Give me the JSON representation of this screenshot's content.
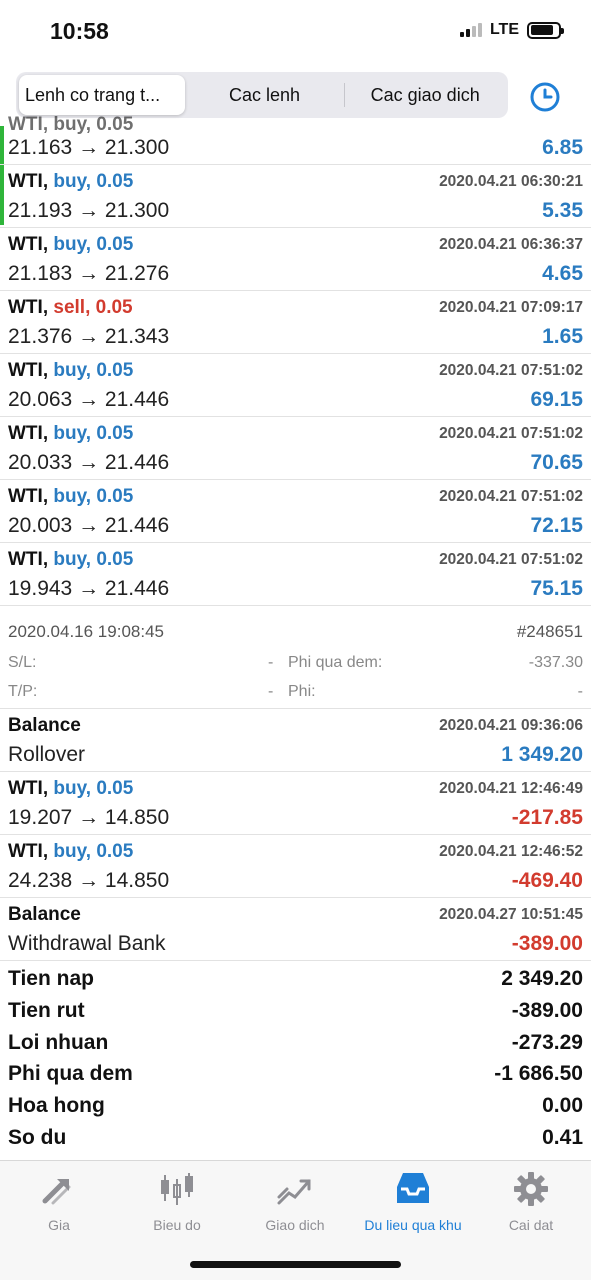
{
  "status_bar": {
    "time": "10:58",
    "network": "LTE"
  },
  "header": {
    "segments": [
      {
        "label": "Lenh co trang t..."
      },
      {
        "label": "Cac lenh"
      },
      {
        "label": "Cac giao dich"
      }
    ],
    "active_segment": 0,
    "history_icon": "clock-icon"
  },
  "partial_row": {
    "symbol": "WTI, buy, 0.05",
    "prices": "21.163 → 21.300",
    "profit": "6.85"
  },
  "deals": [
    {
      "symbol": "WTI,",
      "direction": "buy, 0.05",
      "time": "2020.04.21 06:30:21",
      "prices": "21.193 → 21.300",
      "profit": "5.35"
    },
    {
      "symbol": "WTI,",
      "direction": "buy, 0.05",
      "time": "2020.04.21 06:36:37",
      "prices": "21.183 → 21.276",
      "profit": "4.65"
    },
    {
      "symbol": "WTI,",
      "direction": "sell, 0.05",
      "time": "2020.04.21 07:09:17",
      "prices": "21.376 → 21.343",
      "profit": "1.65"
    },
    {
      "symbol": "WTI,",
      "direction": "buy, 0.05",
      "time": "2020.04.21 07:51:02",
      "prices": "20.063 → 21.446",
      "profit": "69.15"
    },
    {
      "symbol": "WTI,",
      "direction": "buy, 0.05",
      "time": "2020.04.21 07:51:02",
      "prices": "20.033 → 21.446",
      "profit": "70.65"
    },
    {
      "symbol": "WTI,",
      "direction": "buy, 0.05",
      "time": "2020.04.21 07:51:02",
      "prices": "20.003 → 21.446",
      "profit": "72.15"
    },
    {
      "symbol": "WTI,",
      "direction": "buy, 0.05",
      "time": "2020.04.21 07:51:02",
      "prices": "19.943 → 21.446",
      "profit": "75.15"
    }
  ],
  "detail": {
    "open_time": "2020.04.16 19:08:45",
    "ticket": "#248651",
    "sl_label": "S/L:",
    "sl_value": "-",
    "swap_label": "Phi qua dem:",
    "swap_value": "-337.30",
    "tp_label": "T/P:",
    "tp_value": "-",
    "fee_label": "Phi:",
    "fee_value": "-"
  },
  "deals2": [
    {
      "symbol": "Balance",
      "direction": "",
      "time": "2020.04.21 09:36:06",
      "prices": "Rollover",
      "profit": "1 349.20"
    },
    {
      "symbol": "WTI,",
      "direction": "buy, 0.05",
      "time": "2020.04.21 12:46:49",
      "prices": "19.207 → 14.850",
      "profit": "-217.85"
    },
    {
      "symbol": "WTI,",
      "direction": "buy, 0.05",
      "time": "2020.04.21 12:46:52",
      "prices": "24.238 → 14.850",
      "profit": "-469.40"
    },
    {
      "symbol": "Balance",
      "direction": "",
      "time": "2020.04.27 10:51:45",
      "prices": "Withdrawal Bank",
      "profit": "-389.00"
    }
  ],
  "summary": [
    {
      "label": "Tien nap",
      "value": "2 349.20"
    },
    {
      "label": "Tien rut",
      "value": "-389.00"
    },
    {
      "label": "Loi nhuan",
      "value": "-273.29"
    },
    {
      "label": "Phi qua dem",
      "value": "-1 686.50"
    },
    {
      "label": "Hoa hong",
      "value": "0.00"
    },
    {
      "label": "So du",
      "value": "0.41"
    }
  ],
  "tabs": [
    {
      "label": "Gia",
      "icon": "quotes-arrows-icon"
    },
    {
      "label": "Bieu do",
      "icon": "candlestick-chart-icon"
    },
    {
      "label": "Giao dich",
      "icon": "trade-chart-icon"
    },
    {
      "label": "Du lieu qua khu",
      "icon": "history-inbox-icon"
    },
    {
      "label": "Cai dat",
      "icon": "gear-icon"
    }
  ],
  "active_tab": 3,
  "colors": {
    "buy": "#2a7bc0",
    "sell": "#d23b2e",
    "accent": "#1f7fd6",
    "open_marker": "#2fb53a"
  }
}
